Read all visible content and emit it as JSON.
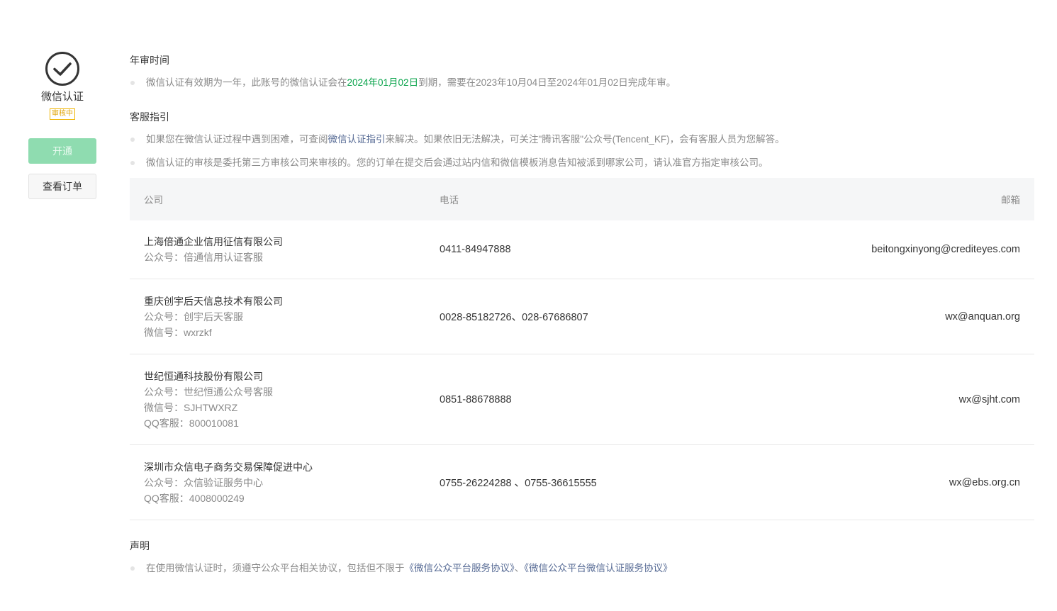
{
  "sidebar": {
    "service_name": "微信认证",
    "status": "审核中",
    "open_button": "开通",
    "orders_button": "查看订单"
  },
  "annual_review": {
    "title": "年审时间",
    "text_before": "微信认证有效期为一年，此账号的微信认证会在",
    "expiry_date": "2024年01月02日",
    "text_after": "到期，需要在2023年10月04日至2024年01月02日完成年审。"
  },
  "support": {
    "title": "客服指引",
    "line1_before": "如果您在微信认证过程中遇到困难，可查阅",
    "line1_link": "微信认证指引",
    "line1_after": "来解决。如果依旧无法解决，可关注\"腾讯客服\"公众号(Tencent_KF)，会有客服人员为您解答。",
    "line2": "微信认证的审核是委托第三方审核公司来审核的。您的订单在提交后会通过站内信和微信模板消息告知被派到哪家公司，请认准官方指定审核公司。"
  },
  "table": {
    "headers": {
      "company": "公司",
      "phone": "电话",
      "email": "邮箱"
    },
    "rows": [
      {
        "name": "上海倍通企业信用征信有限公司",
        "meta": [
          "公众号：倍通信用认证客服"
        ],
        "phone": "0411-84947888",
        "email": "beitongxinyong@crediteyes.com"
      },
      {
        "name": "重庆创宇后天信息技术有限公司",
        "meta": [
          "公众号：创宇后天客服",
          "微信号：wxrzkf"
        ],
        "phone": "0028-85182726、028-67686807",
        "email": "wx@anquan.org"
      },
      {
        "name": "世纪恒通科技股份有限公司",
        "meta": [
          "公众号：世纪恒通公众号客服",
          "微信号：SJHTWXRZ",
          "QQ客服：800010081"
        ],
        "phone": "0851-88678888",
        "email": "wx@sjht.com"
      },
      {
        "name": "深圳市众信电子商务交易保障促进中心",
        "meta": [
          "公众号：众信验证服务中心",
          "QQ客服：4008000249"
        ],
        "phone": "0755-26224288 、0755-36615555",
        "email": "wx@ebs.org.cn"
      }
    ]
  },
  "statement": {
    "title": "声明",
    "text_before": "在使用微信认证时，须遵守公众平台相关协议，包括但不限于",
    "link1": "《微信公众平台服务协议》",
    "separator": "、",
    "link2": "《微信公众平台微信认证服务协议》"
  },
  "colors": {
    "accent_green": "#07a34a",
    "link_blue": "#576b95",
    "badge_orange": "#e0a300"
  }
}
